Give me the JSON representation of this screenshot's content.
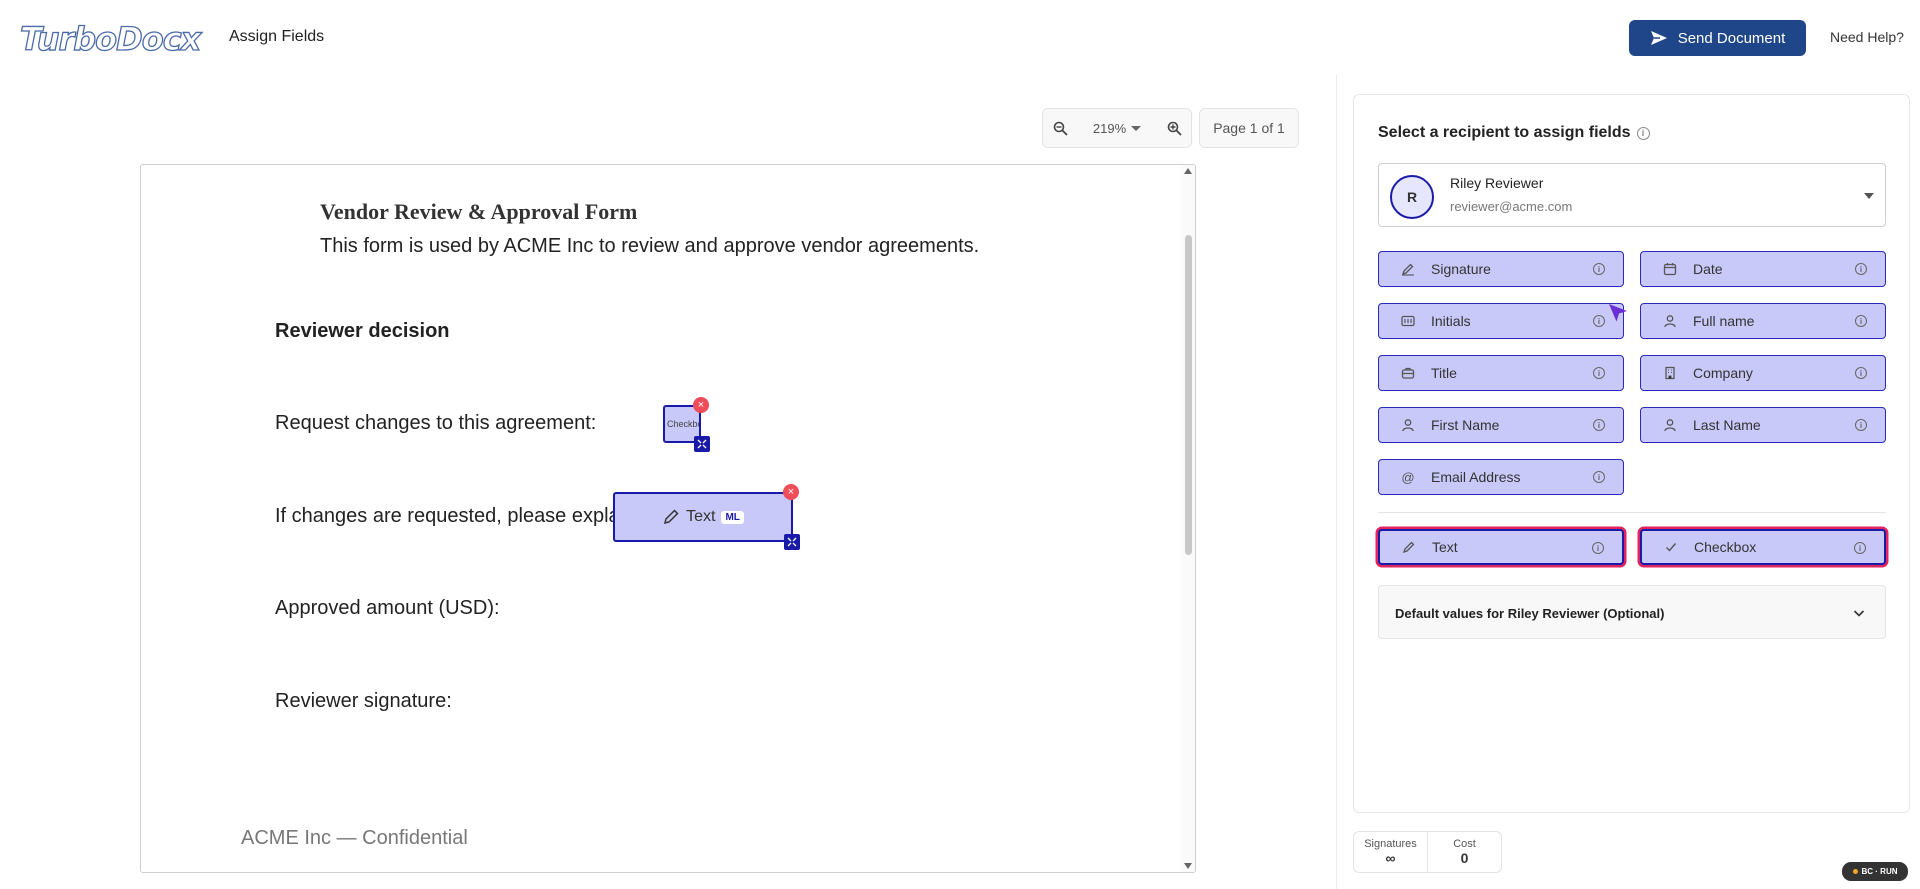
{
  "header": {
    "logo_text": "TurboDocx",
    "page_title": "Assign Fields",
    "send_label": "Send Document",
    "help_label": "Need Help?"
  },
  "viewer": {
    "zoom_level": "219%",
    "page_indicator": "Page 1 of 1"
  },
  "document": {
    "title": "Vendor Review & Approval Form",
    "subtitle": "This form is used by ACME Inc to review and approve vendor agreements.",
    "section_heading": "Reviewer decision",
    "line_request_changes": "Request changes to this agreement:",
    "line_explain": "If changes are requested, please explain:",
    "line_amount": "Approved amount (USD):",
    "line_signature": "Reviewer signature:",
    "footer": "ACME Inc — Confidential"
  },
  "placed_fields": {
    "checkbox_label": "Checkbox",
    "text_label": "Text",
    "text_badge": "ML",
    "remove_symbol": "×"
  },
  "panel": {
    "title": "Select a recipient to assign fields",
    "info_symbol": "i",
    "recipient": {
      "initial": "R",
      "name": "Riley Reviewer",
      "email": "reviewer@acme.com"
    },
    "fields": [
      {
        "label": "Signature",
        "icon": "signature-icon"
      },
      {
        "label": "Date",
        "icon": "calendar-icon"
      },
      {
        "label": "Initials",
        "icon": "initials-icon"
      },
      {
        "label": "Full name",
        "icon": "person-icon"
      },
      {
        "label": "Title",
        "icon": "briefcase-icon"
      },
      {
        "label": "Company",
        "icon": "building-icon"
      },
      {
        "label": "First Name",
        "icon": "person-icon"
      },
      {
        "label": "Last Name",
        "icon": "person-icon"
      },
      {
        "label": "Email Address",
        "icon": "at-icon"
      }
    ],
    "custom_fields": [
      {
        "label": "Text",
        "icon": "pencil-icon"
      },
      {
        "label": "Checkbox",
        "icon": "check-icon"
      }
    ],
    "defaults_label": "Default values for Riley Reviewer (Optional)"
  },
  "stats": {
    "signatures_label": "Signatures",
    "signatures_value": "∞",
    "cost_label": "Cost",
    "cost_value": "0"
  },
  "badge": {
    "label": "BC · RUN"
  },
  "colors": {
    "primary": "#1f4688",
    "field_fill": "#c8c9f8",
    "field_border": "#1a1aa8",
    "highlight": "#e0245e",
    "remove": "#ef4d5a"
  }
}
